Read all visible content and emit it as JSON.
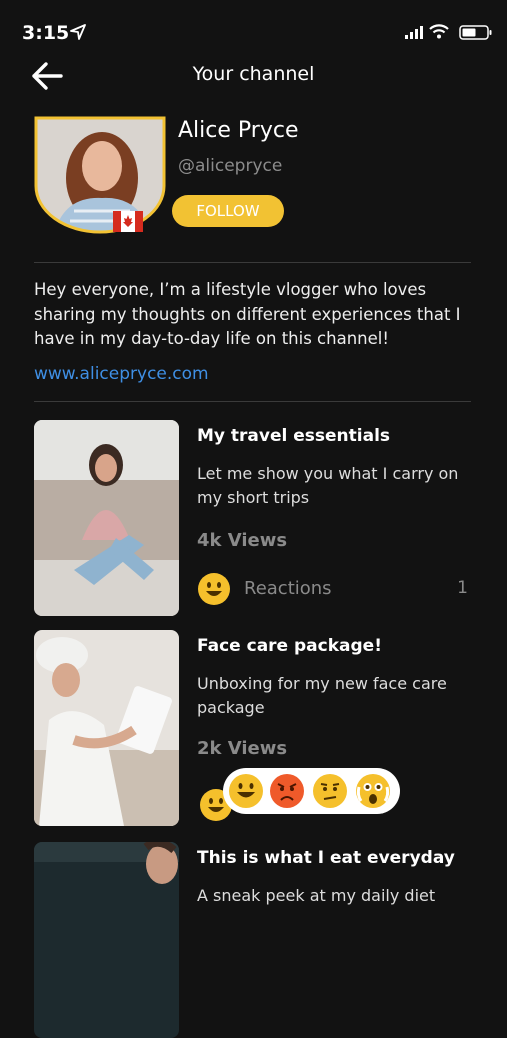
{
  "status": {
    "time": "3:15"
  },
  "header": {
    "title": "Your channel"
  },
  "profile": {
    "name": "Alice Pryce",
    "handle": "@alicepryce",
    "follow_label": "FOLLOW"
  },
  "bio": {
    "text": "Hey everyone, I’m a lifestyle vlogger who loves sharing my thoughts on different experiences that I have in my day-to-day life on this channel!",
    "link": "www.alicepryce.com"
  },
  "videos": [
    {
      "title": "My travel essentials",
      "description": "Let me show you what I carry on my short trips",
      "views": "4k Views",
      "reactions_label": "Reactions",
      "reactions_count": "1"
    },
    {
      "title": "Face care package!",
      "description": "Unboxing for my new face care package",
      "views": "2k Views"
    },
    {
      "title": "This is what I eat everyday",
      "description": "A sneak peek at my daily diet"
    }
  ],
  "colors": {
    "background": "#121212",
    "accent": "#f2c233",
    "link": "#3f8fe4"
  }
}
